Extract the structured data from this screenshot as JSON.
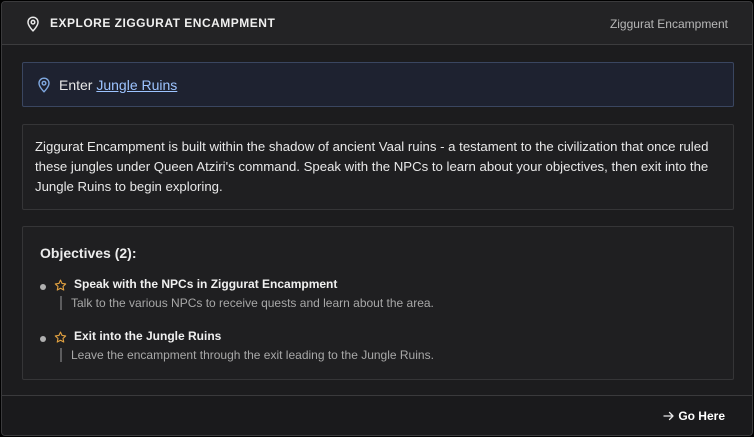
{
  "header": {
    "title": "EXPLORE ZIGGURAT ENCAMPMENT",
    "location": "Ziggurat Encampment",
    "icon": "map-pin-icon"
  },
  "enter": {
    "prefix": "Enter ",
    "link_text": "Jungle Ruins",
    "icon": "map-pin-icon"
  },
  "description": "Ziggurat Encampment is built within the shadow of ancient Vaal ruins - a testament to the civilization that once ruled these jungles under Queen Atziri's command. Speak with the NPCs to learn about your objectives, then exit into the Jungle Ruins to begin exploring.",
  "objectives": {
    "title": "Objectives (2):",
    "items": [
      {
        "name": "Speak with the NPCs in Ziggurat Encampment",
        "desc": "Talk to the various NPCs to receive quests and learn about the area."
      },
      {
        "name": "Exit into the Jungle Ruins",
        "desc": "Leave the encampment through the exit leading to the Jungle Ruins."
      }
    ]
  },
  "footer": {
    "go_label": "Go Here",
    "icon": "arrow-right-icon"
  },
  "colors": {
    "accent_link": "#9dc4ff",
    "star": "#e0a040",
    "background": "#1c1c1e"
  }
}
